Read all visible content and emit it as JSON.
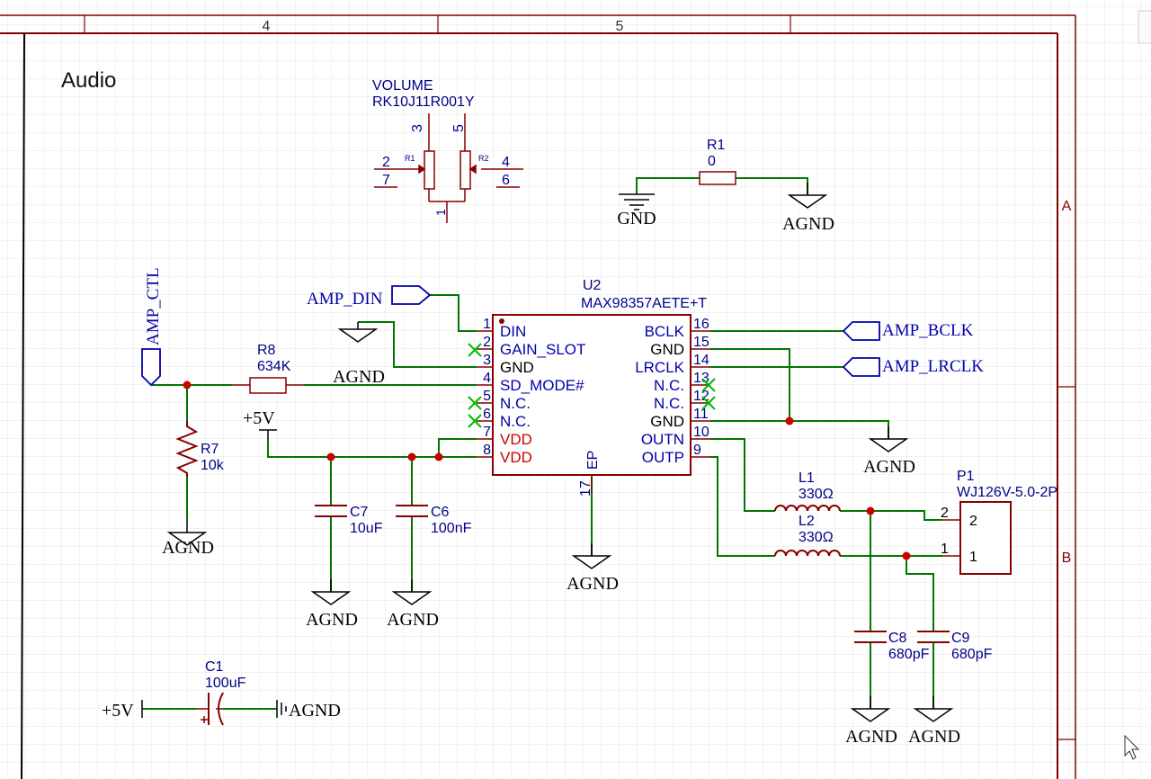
{
  "frame": {
    "zones": [
      "4",
      "5"
    ],
    "rows": [
      "A",
      "B"
    ]
  },
  "sheet_title": "Audio",
  "volume": {
    "name": "VOLUME",
    "part": "RK10J11R001Y",
    "sub1": "R1",
    "sub2": "R2",
    "pins": [
      "3",
      "5",
      "2",
      "7",
      "4",
      "6",
      "1"
    ]
  },
  "r1": {
    "ref": "R1",
    "value": "0",
    "left_net": "GND",
    "right_net": "AGND"
  },
  "u2": {
    "ref": "U2",
    "part": "MAX98357AETE+T",
    "left_pins": [
      {
        "num": "1",
        "name": "DIN",
        "color": "#0000aa"
      },
      {
        "num": "2",
        "name": "GAIN_SLOT",
        "color": "#0000aa"
      },
      {
        "num": "3",
        "name": "GND",
        "color": "#000000"
      },
      {
        "num": "4",
        "name": "SD_MODE#",
        "color": "#0000aa"
      },
      {
        "num": "5",
        "name": "N.C.",
        "color": "#0000aa"
      },
      {
        "num": "6",
        "name": "N.C.",
        "color": "#0000aa"
      },
      {
        "num": "7",
        "name": "VDD",
        "color": "#cc0000"
      },
      {
        "num": "8",
        "name": "VDD",
        "color": "#cc0000"
      }
    ],
    "right_pins": [
      {
        "num": "16",
        "name": "BCLK",
        "color": "#0000aa"
      },
      {
        "num": "15",
        "name": "GND",
        "color": "#000000"
      },
      {
        "num": "14",
        "name": "LRCLK",
        "color": "#0000aa"
      },
      {
        "num": "13",
        "name": "N.C.",
        "color": "#0000aa"
      },
      {
        "num": "12",
        "name": "N.C.",
        "color": "#0000aa"
      },
      {
        "num": "11",
        "name": "GND",
        "color": "#000000"
      },
      {
        "num": "10",
        "name": "OUTN",
        "color": "#0000aa"
      },
      {
        "num": "9",
        "name": "OUTP",
        "color": "#0000aa"
      }
    ],
    "ep_num": "17",
    "ep_name": "EP"
  },
  "ports": {
    "amp_din": "AMP_DIN",
    "amp_ctl": "AMP_CTL",
    "amp_bclk": "AMP_BCLK",
    "amp_lrclk": "AMP_LRCLK"
  },
  "r8": {
    "ref": "R8",
    "value": "634K"
  },
  "r7": {
    "ref": "R7",
    "value": "10k"
  },
  "c7": {
    "ref": "C7",
    "value": "10uF"
  },
  "c6": {
    "ref": "C6",
    "value": "100nF"
  },
  "c1": {
    "ref": "C1",
    "value": "100uF"
  },
  "c8": {
    "ref": "C8",
    "value": "680pF"
  },
  "c9": {
    "ref": "C9",
    "value": "680pF"
  },
  "l1": {
    "ref": "L1",
    "value": "330Ω"
  },
  "l2": {
    "ref": "L2",
    "value": "330Ω"
  },
  "p1": {
    "ref": "P1",
    "part": "WJ126V-5.0-2P",
    "pin_outer_2": "2",
    "pin_inner_2": "2",
    "pin_outer_1": "1",
    "pin_inner_1": "1"
  },
  "power": {
    "v5": "+5V",
    "agnd": "AGND",
    "gnd": "GND"
  },
  "colors": {
    "wire": "#007700",
    "component": "#880000",
    "text": "#000088",
    "junction": "#cc0000",
    "frame": "#800000",
    "grid": "#e6e6e6",
    "nc": "#00bb00"
  }
}
